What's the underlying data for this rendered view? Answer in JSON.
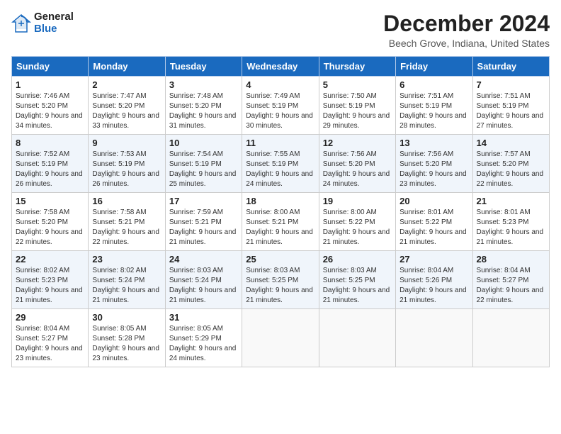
{
  "logo": {
    "general": "General",
    "blue": "Blue"
  },
  "title": "December 2024",
  "location": "Beech Grove, Indiana, United States",
  "days_of_week": [
    "Sunday",
    "Monday",
    "Tuesday",
    "Wednesday",
    "Thursday",
    "Friday",
    "Saturday"
  ],
  "weeks": [
    [
      {
        "day": "1",
        "sunrise": "Sunrise: 7:46 AM",
        "sunset": "Sunset: 5:20 PM",
        "daylight": "Daylight: 9 hours and 34 minutes."
      },
      {
        "day": "2",
        "sunrise": "Sunrise: 7:47 AM",
        "sunset": "Sunset: 5:20 PM",
        "daylight": "Daylight: 9 hours and 33 minutes."
      },
      {
        "day": "3",
        "sunrise": "Sunrise: 7:48 AM",
        "sunset": "Sunset: 5:20 PM",
        "daylight": "Daylight: 9 hours and 31 minutes."
      },
      {
        "day": "4",
        "sunrise": "Sunrise: 7:49 AM",
        "sunset": "Sunset: 5:19 PM",
        "daylight": "Daylight: 9 hours and 30 minutes."
      },
      {
        "day": "5",
        "sunrise": "Sunrise: 7:50 AM",
        "sunset": "Sunset: 5:19 PM",
        "daylight": "Daylight: 9 hours and 29 minutes."
      },
      {
        "day": "6",
        "sunrise": "Sunrise: 7:51 AM",
        "sunset": "Sunset: 5:19 PM",
        "daylight": "Daylight: 9 hours and 28 minutes."
      },
      {
        "day": "7",
        "sunrise": "Sunrise: 7:51 AM",
        "sunset": "Sunset: 5:19 PM",
        "daylight": "Daylight: 9 hours and 27 minutes."
      }
    ],
    [
      {
        "day": "8",
        "sunrise": "Sunrise: 7:52 AM",
        "sunset": "Sunset: 5:19 PM",
        "daylight": "Daylight: 9 hours and 26 minutes."
      },
      {
        "day": "9",
        "sunrise": "Sunrise: 7:53 AM",
        "sunset": "Sunset: 5:19 PM",
        "daylight": "Daylight: 9 hours and 26 minutes."
      },
      {
        "day": "10",
        "sunrise": "Sunrise: 7:54 AM",
        "sunset": "Sunset: 5:19 PM",
        "daylight": "Daylight: 9 hours and 25 minutes."
      },
      {
        "day": "11",
        "sunrise": "Sunrise: 7:55 AM",
        "sunset": "Sunset: 5:19 PM",
        "daylight": "Daylight: 9 hours and 24 minutes."
      },
      {
        "day": "12",
        "sunrise": "Sunrise: 7:56 AM",
        "sunset": "Sunset: 5:20 PM",
        "daylight": "Daylight: 9 hours and 24 minutes."
      },
      {
        "day": "13",
        "sunrise": "Sunrise: 7:56 AM",
        "sunset": "Sunset: 5:20 PM",
        "daylight": "Daylight: 9 hours and 23 minutes."
      },
      {
        "day": "14",
        "sunrise": "Sunrise: 7:57 AM",
        "sunset": "Sunset: 5:20 PM",
        "daylight": "Daylight: 9 hours and 22 minutes."
      }
    ],
    [
      {
        "day": "15",
        "sunrise": "Sunrise: 7:58 AM",
        "sunset": "Sunset: 5:20 PM",
        "daylight": "Daylight: 9 hours and 22 minutes."
      },
      {
        "day": "16",
        "sunrise": "Sunrise: 7:58 AM",
        "sunset": "Sunset: 5:21 PM",
        "daylight": "Daylight: 9 hours and 22 minutes."
      },
      {
        "day": "17",
        "sunrise": "Sunrise: 7:59 AM",
        "sunset": "Sunset: 5:21 PM",
        "daylight": "Daylight: 9 hours and 21 minutes."
      },
      {
        "day": "18",
        "sunrise": "Sunrise: 8:00 AM",
        "sunset": "Sunset: 5:21 PM",
        "daylight": "Daylight: 9 hours and 21 minutes."
      },
      {
        "day": "19",
        "sunrise": "Sunrise: 8:00 AM",
        "sunset": "Sunset: 5:22 PM",
        "daylight": "Daylight: 9 hours and 21 minutes."
      },
      {
        "day": "20",
        "sunrise": "Sunrise: 8:01 AM",
        "sunset": "Sunset: 5:22 PM",
        "daylight": "Daylight: 9 hours and 21 minutes."
      },
      {
        "day": "21",
        "sunrise": "Sunrise: 8:01 AM",
        "sunset": "Sunset: 5:23 PM",
        "daylight": "Daylight: 9 hours and 21 minutes."
      }
    ],
    [
      {
        "day": "22",
        "sunrise": "Sunrise: 8:02 AM",
        "sunset": "Sunset: 5:23 PM",
        "daylight": "Daylight: 9 hours and 21 minutes."
      },
      {
        "day": "23",
        "sunrise": "Sunrise: 8:02 AM",
        "sunset": "Sunset: 5:24 PM",
        "daylight": "Daylight: 9 hours and 21 minutes."
      },
      {
        "day": "24",
        "sunrise": "Sunrise: 8:03 AM",
        "sunset": "Sunset: 5:24 PM",
        "daylight": "Daylight: 9 hours and 21 minutes."
      },
      {
        "day": "25",
        "sunrise": "Sunrise: 8:03 AM",
        "sunset": "Sunset: 5:25 PM",
        "daylight": "Daylight: 9 hours and 21 minutes."
      },
      {
        "day": "26",
        "sunrise": "Sunrise: 8:03 AM",
        "sunset": "Sunset: 5:25 PM",
        "daylight": "Daylight: 9 hours and 21 minutes."
      },
      {
        "day": "27",
        "sunrise": "Sunrise: 8:04 AM",
        "sunset": "Sunset: 5:26 PM",
        "daylight": "Daylight: 9 hours and 21 minutes."
      },
      {
        "day": "28",
        "sunrise": "Sunrise: 8:04 AM",
        "sunset": "Sunset: 5:27 PM",
        "daylight": "Daylight: 9 hours and 22 minutes."
      }
    ],
    [
      {
        "day": "29",
        "sunrise": "Sunrise: 8:04 AM",
        "sunset": "Sunset: 5:27 PM",
        "daylight": "Daylight: 9 hours and 23 minutes."
      },
      {
        "day": "30",
        "sunrise": "Sunrise: 8:05 AM",
        "sunset": "Sunset: 5:28 PM",
        "daylight": "Daylight: 9 hours and 23 minutes."
      },
      {
        "day": "31",
        "sunrise": "Sunrise: 8:05 AM",
        "sunset": "Sunset: 5:29 PM",
        "daylight": "Daylight: 9 hours and 24 minutes."
      },
      {
        "day": "",
        "sunrise": "",
        "sunset": "",
        "daylight": ""
      },
      {
        "day": "",
        "sunrise": "",
        "sunset": "",
        "daylight": ""
      },
      {
        "day": "",
        "sunrise": "",
        "sunset": "",
        "daylight": ""
      },
      {
        "day": "",
        "sunrise": "",
        "sunset": "",
        "daylight": ""
      }
    ]
  ]
}
